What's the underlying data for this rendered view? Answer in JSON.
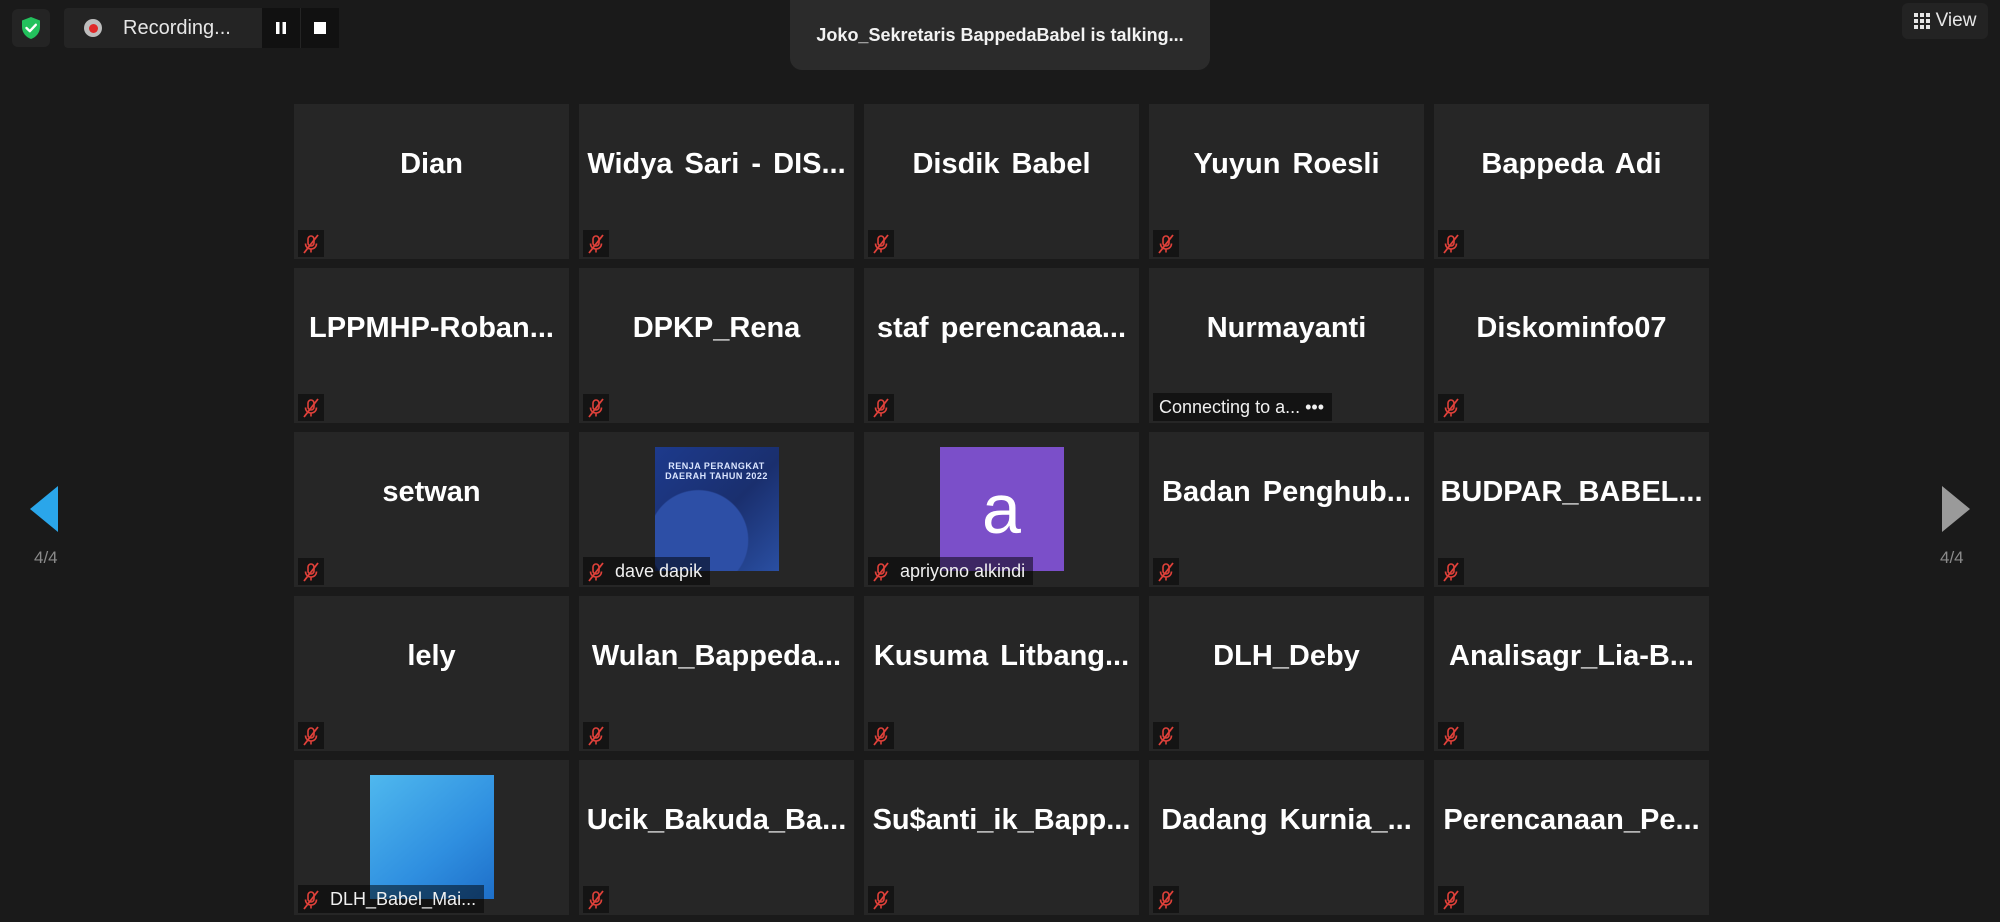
{
  "toolbar": {
    "recording_label": "Recording...",
    "view_label": "View"
  },
  "banner": {
    "talking_text": "Joko_Sekretaris BappedaBabel is talking..."
  },
  "pagination": {
    "left_label": "4/4",
    "right_label": "4/4"
  },
  "colors": {
    "background": "#1a1a1a",
    "tile": "#262626",
    "mute_red": "#e0413a",
    "nav_arrow_active": "#2aa6ea",
    "nav_arrow_inactive": "#9a9a9a"
  },
  "participants": [
    {
      "name": "Dian",
      "muted": true
    },
    {
      "name": "Widya Sari - DIS...",
      "muted": true
    },
    {
      "name": "Disdik Babel",
      "muted": true
    },
    {
      "name": "Yuyun Roesli",
      "muted": true
    },
    {
      "name": "Bappeda Adi",
      "muted": true
    },
    {
      "name": "LPPMHP-Roban...",
      "muted": true
    },
    {
      "name": "DPKP_Rena",
      "muted": true
    },
    {
      "name": "staf perencanaa...",
      "muted": true
    },
    {
      "name": "Nurmayanti",
      "muted": false,
      "status": "Connecting to a...  •••"
    },
    {
      "name": "Diskominfo07",
      "muted": true
    },
    {
      "name": "setwan",
      "muted": true
    },
    {
      "name": "dave dapik",
      "muted": true,
      "video": "doc1",
      "doc_text": "RENJA PERANGKAT DAERAH TAHUN 2022"
    },
    {
      "name": "apriyono alkindi",
      "muted": true,
      "video": "avatar",
      "avatar_letter": "a"
    },
    {
      "name": "Badan Penghub...",
      "muted": true
    },
    {
      "name": "BUDPAR_BABEL...",
      "muted": true
    },
    {
      "name": "lely",
      "muted": true
    },
    {
      "name": "Wulan_Bappeda...",
      "muted": true
    },
    {
      "name": "Kusuma Litbang...",
      "muted": true
    },
    {
      "name": "DLH_Deby",
      "muted": true
    },
    {
      "name": "Analisagr_Lia-B...",
      "muted": true
    },
    {
      "name": "DLH_Babel_Mai...",
      "muted": true,
      "video": "doc2"
    },
    {
      "name": "Ucik_Bakuda_Ba...",
      "muted": true
    },
    {
      "name": "Su$anti_ik_Bapp...",
      "muted": true
    },
    {
      "name": "Dadang Kurnia_...",
      "muted": true
    },
    {
      "name": "Perencanaan_Pe...",
      "muted": true
    }
  ]
}
